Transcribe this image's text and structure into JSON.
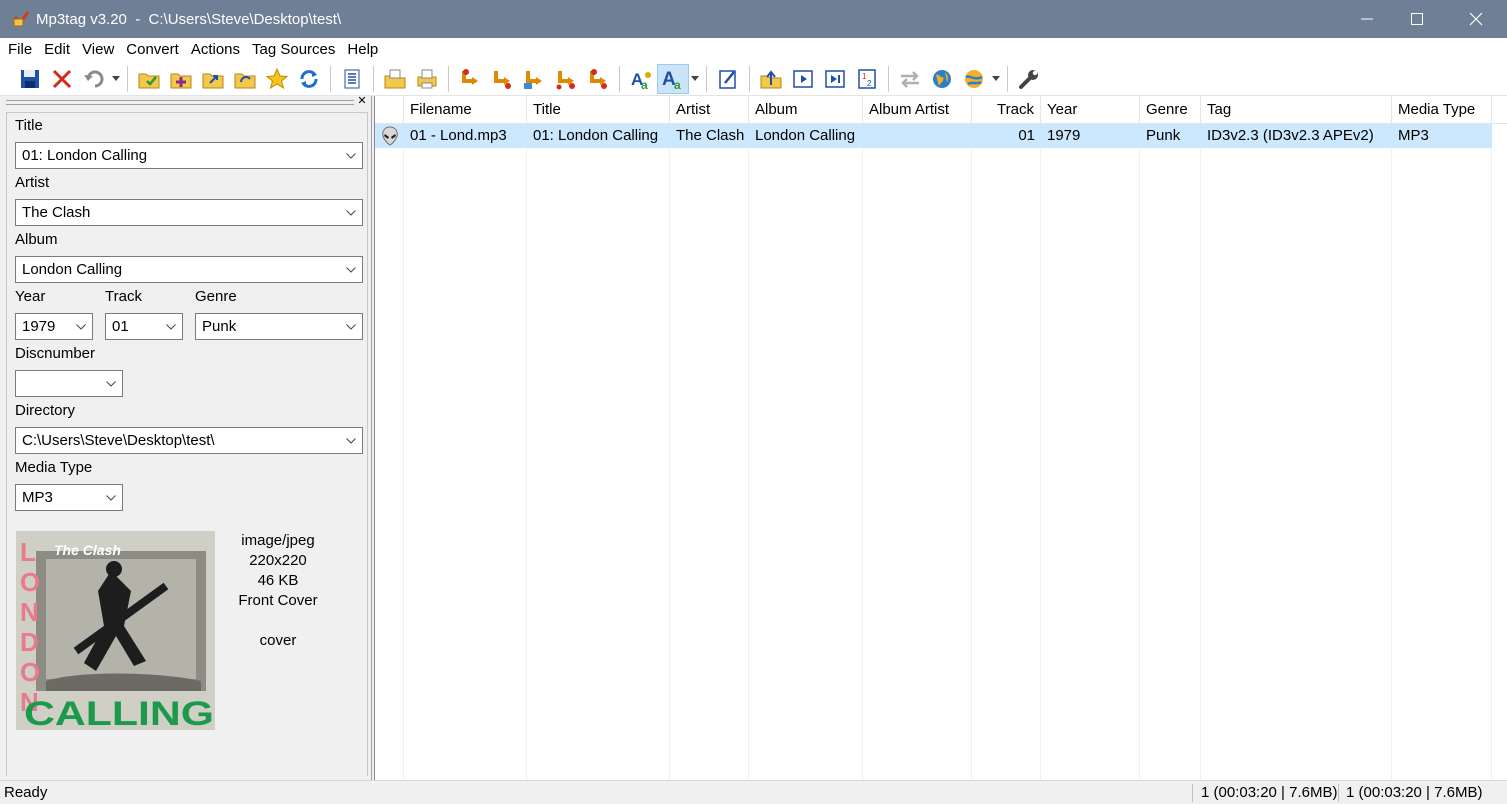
{
  "window": {
    "title": "Mp3tag v3.20  -  C:\\Users\\Steve\\Desktop\\test\\",
    "controls": [
      "minimize-icon",
      "maximize-icon",
      "close-icon"
    ]
  },
  "menu": [
    "File",
    "Edit",
    "View",
    "Convert",
    "Actions",
    "Tag Sources",
    "Help"
  ],
  "toolbar": {
    "icons": [
      "save-icon",
      "remove-tag-icon",
      "undo-icon",
      "change-directory-icon",
      "add-directory-icon",
      "import-cover-icon",
      "refresh-icon",
      "favorites-star-icon",
      "reload-icon",
      "playlist-icon",
      "export-icon",
      "print-icon",
      "tag-filename-icon",
      "filename-tag-icon",
      "filename-filename-icon",
      "text-tag-icon",
      "tag-tag-icon",
      "autonumber-icon",
      "case-conversion-icon",
      "extended-tags-icon",
      "parent-folder-icon",
      "play-icon",
      "play-next-icon",
      "numbering-icon",
      "compare-icon",
      "web-source-icon",
      "web-sources-icon",
      "options-wrench-icon"
    ]
  },
  "tag_panel": {
    "title_label": "Title",
    "title_value": "01:  London Calling",
    "artist_label": "Artist",
    "artist_value": "The Clash",
    "album_label": "Album",
    "album_value": "London Calling",
    "year_label": "Year",
    "year_value": "1979",
    "track_label": "Track",
    "track_value": "01",
    "genre_label": "Genre",
    "genre_value": "Punk",
    "discnumber_label": "Discnumber",
    "discnumber_value": "",
    "directory_label": "Directory",
    "directory_value": "C:\\Users\\Steve\\Desktop\\test\\",
    "mediatype_label": "Media Type",
    "mediatype_value": "MP3",
    "cover": {
      "band": "The Clash",
      "word1": "LONDON",
      "word2": "CALLING",
      "mime": "image/jpeg",
      "size": "220x220",
      "filesize": "46 KB",
      "type": "Front Cover",
      "description": "cover"
    }
  },
  "file_list": {
    "columns": [
      "Filename",
      "Title",
      "Artist",
      "Album",
      "Album Artist",
      "Track",
      "Year",
      "Genre",
      "Tag",
      "Media Type"
    ],
    "rows": [
      {
        "filename": "01 - Lond.mp3",
        "title": "01:  London Calling",
        "artist": "The Clash",
        "album": "London Calling",
        "album_artist": "",
        "track": "01",
        "year": "1979",
        "genre": "Punk",
        "tag": "ID3v2.3 (ID3v2.3 APEv2)",
        "media_type": "MP3"
      }
    ]
  },
  "status": {
    "text": "Ready",
    "selected": "1 (00:03:20 | 7.6MB)",
    "total": "1 (00:03:20 | 7.6MB)"
  },
  "colors": {
    "titlebar": "#6f7f95",
    "selection": "#cce8ff",
    "active_tool": "#cce4f7"
  }
}
